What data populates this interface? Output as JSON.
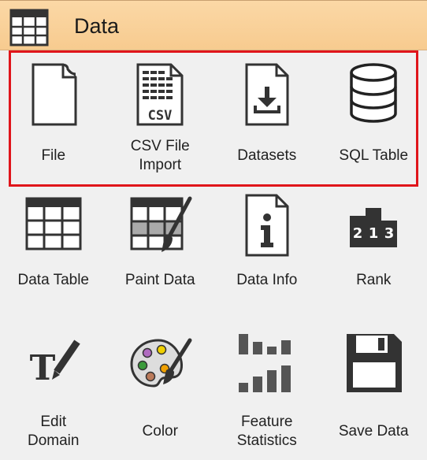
{
  "header": {
    "title": "Data",
    "icon": "data-table-icon",
    "bg_color": "#f9d19b"
  },
  "highlight_color": "#e0151b",
  "widgets": [
    {
      "label": "File",
      "icon": "file-icon"
    },
    {
      "label": "CSV File\nImport",
      "icon": "csv-file-icon"
    },
    {
      "label": "Datasets",
      "icon": "datasets-download-icon"
    },
    {
      "label": "SQL Table",
      "icon": "database-icon"
    },
    {
      "label": "Data Table",
      "icon": "data-table-icon"
    },
    {
      "label": "Paint Data",
      "icon": "paint-data-icon"
    },
    {
      "label": "Data Info",
      "icon": "info-document-icon"
    },
    {
      "label": "Rank",
      "icon": "podium-rank-icon"
    },
    {
      "label": "Edit\nDomain",
      "icon": "edit-domain-icon"
    },
    {
      "label": "Color",
      "icon": "color-palette-icon"
    },
    {
      "label": "Feature\nStatistics",
      "icon": "feature-statistics-icon"
    },
    {
      "label": "Save Data",
      "icon": "floppy-disk-icon"
    }
  ]
}
